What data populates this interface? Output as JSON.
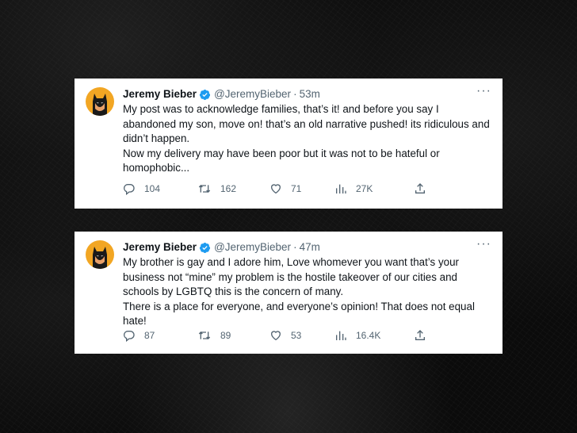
{
  "colors": {
    "text": "#0f1419",
    "muted": "#536471",
    "verified": "#1d9bf0",
    "avatar_bg": "#f2a623"
  },
  "tweets": [
    {
      "author": {
        "name": "Jeremy Bieber",
        "handle": "@JeremyBieber",
        "avatar": "batman-avatar",
        "verified": true
      },
      "time": "53m",
      "dot": "·",
      "more": "···",
      "lines": [
        "My post was to acknowledge families, that’s it! and before you say I abandoned my son, move on! that’s an old narrative pushed! its ridiculous and didn’t happen.",
        "Now my delivery may have been poor but it was not to be hateful or homophobic..."
      ],
      "stats": {
        "replies": "104",
        "retweets": "162",
        "likes": "71",
        "views": "27K"
      }
    },
    {
      "author": {
        "name": "Jeremy Bieber",
        "handle": "@JeremyBieber",
        "avatar": "batman-avatar",
        "verified": true
      },
      "time": "47m",
      "dot": "·",
      "more": "···",
      "lines": [
        "My brother is gay and I adore him, Love whomever you want that’s your business not “mine”  my problem is the hostile takeover of our cities and schools by LGBTQ this is the concern of many.",
        "There is a place for everyone, and everyone’s opinion! That does not equal hate!"
      ],
      "stats": {
        "replies": "87",
        "retweets": "89",
        "likes": "53",
        "views": "16.4K"
      }
    }
  ]
}
